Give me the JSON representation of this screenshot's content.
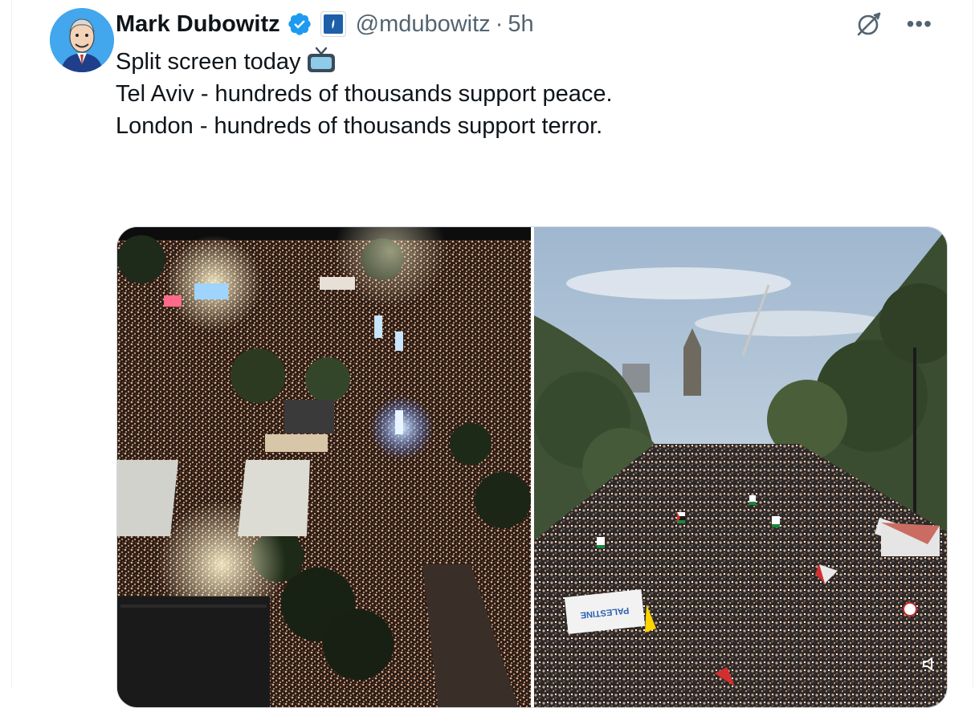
{
  "tweet": {
    "author": {
      "display_name": "Mark Dubowitz",
      "handle": "@mdubowitz",
      "separator": "·",
      "time": "5h"
    },
    "text_lines": [
      "Split screen today",
      "",
      "Tel Aviv - hundreds of thousands support peace.",
      "",
      "London - hundreds of thousands support terror."
    ],
    "media": {
      "left_photo": "Tel Aviv aerial night crowd",
      "right_photo": "London march crowd with flags",
      "banner_text": "PALESTINE"
    }
  },
  "icons": {
    "verified": "verified-badge-icon",
    "affiliate": "affiliate-badge-icon",
    "grok": "grok-icon",
    "more": "more-icon",
    "tv": "tv-emoji-icon",
    "mute": "speaker-mute-icon"
  },
  "colors": {
    "verified_blue": "#1d9bf0",
    "secondary_text": "#536471",
    "primary_text": "#0f1419"
  }
}
